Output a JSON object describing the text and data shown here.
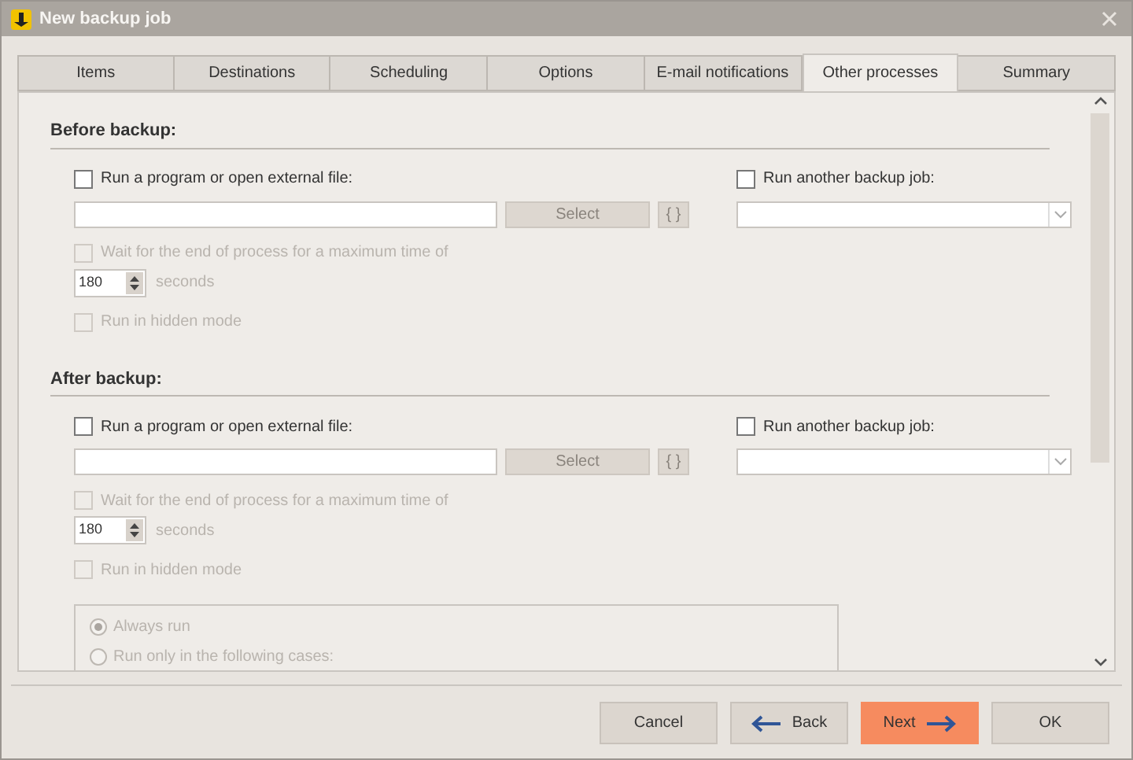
{
  "window": {
    "title": "New backup job"
  },
  "tabs": [
    {
      "label": "Items",
      "selected": false
    },
    {
      "label": "Destinations",
      "selected": false
    },
    {
      "label": "Scheduling",
      "selected": false
    },
    {
      "label": "Options",
      "selected": false
    },
    {
      "label": "E-mail notifications",
      "selected": false
    },
    {
      "label": "Other processes",
      "selected": true
    },
    {
      "label": "Summary",
      "selected": false
    }
  ],
  "sections": [
    {
      "title": "Before backup:",
      "program": {
        "label": "Run a program or open external file:",
        "checked": false
      },
      "select_button": {
        "label": "Select",
        "disabled": true
      },
      "variables_button": {
        "label": "{ }",
        "disabled": true
      },
      "wait": {
        "label": "Wait for the end of process for a maximum time of",
        "checked": false,
        "disabled": true
      },
      "timeout": {
        "value": "180",
        "unit": "seconds"
      },
      "hidden_mode": {
        "label": "Run in hidden mode",
        "checked": false,
        "disabled": true
      },
      "job": {
        "label": "Run another backup job:",
        "checked": false
      }
    },
    {
      "title": "After backup:",
      "program": {
        "label": "Run a program or open external file:",
        "checked": false
      },
      "select_button": {
        "label": "Select",
        "disabled": true
      },
      "variables_button": {
        "label": "{ }",
        "disabled": true
      },
      "wait": {
        "label": "Wait for the end of process for a maximum time of",
        "checked": false,
        "disabled": true
      },
      "timeout": {
        "value": "180",
        "unit": "seconds"
      },
      "hidden_mode": {
        "label": "Run in hidden mode",
        "checked": false,
        "disabled": true
      },
      "job": {
        "label": "Run another backup job:",
        "checked": false
      },
      "run_conditions": [
        {
          "label": "Always run",
          "selected": true
        },
        {
          "label": "Run only in the following cases:",
          "selected": false
        }
      ]
    }
  ],
  "buttons": [
    {
      "label": "Cancel",
      "kind": "cancel",
      "primary": false
    },
    {
      "label": "Back",
      "kind": "back",
      "primary": false
    },
    {
      "label": "Next",
      "kind": "next",
      "primary": true
    },
    {
      "label": "OK",
      "kind": "ok",
      "primary": false
    }
  ]
}
